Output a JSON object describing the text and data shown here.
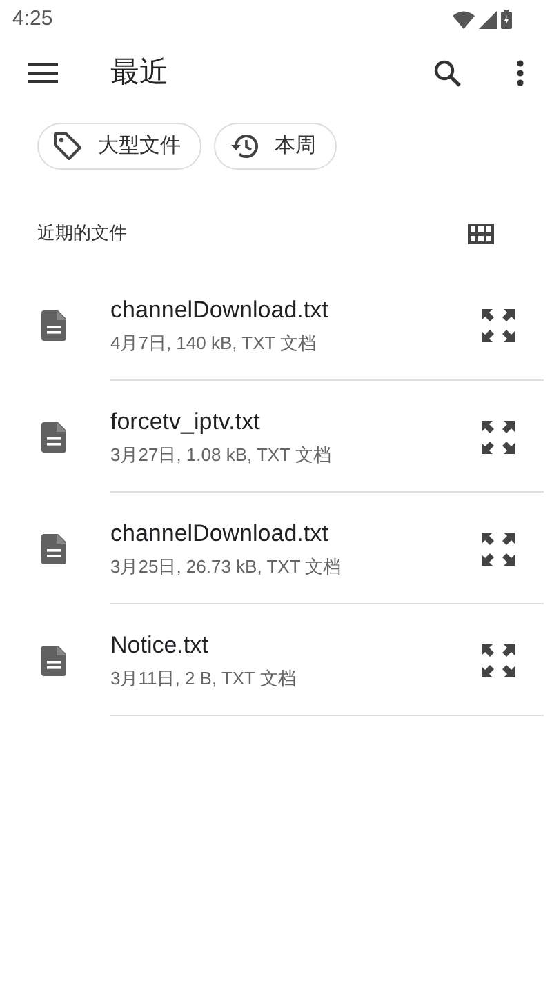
{
  "status_bar": {
    "time": "4:25"
  },
  "app_bar": {
    "title": "最近"
  },
  "chips": [
    {
      "label": "大型文件",
      "kind": "tag"
    },
    {
      "label": "本周",
      "kind": "history"
    }
  ],
  "section": {
    "title": "近期的文件"
  },
  "files": [
    {
      "name": "channelDownload.txt",
      "details": "4月7日, 140 kB, TXT 文档"
    },
    {
      "name": "forcetv_iptv.txt",
      "details": "3月27日, 1.08 kB, TXT 文档"
    },
    {
      "name": "channelDownload.txt",
      "details": "3月25日, 26.73 kB, TXT 文档"
    },
    {
      "name": "Notice.txt",
      "details": "3月11日, 2 B, TXT 文档"
    }
  ]
}
